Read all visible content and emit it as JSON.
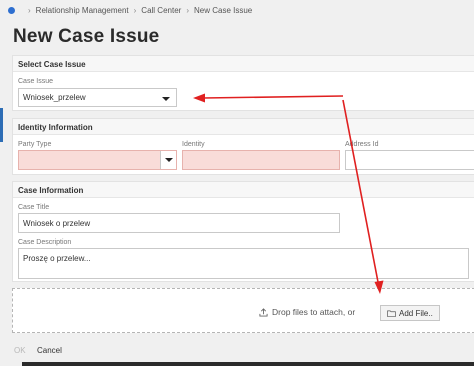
{
  "breadcrumb": {
    "items": [
      "Relationship Management",
      "Call Center",
      "New Case Issue"
    ]
  },
  "page_title": "New Case Issue",
  "select_case_issue": {
    "header": "Select Case Issue",
    "case_issue_label": "Case Issue",
    "case_issue_value": "Wniosek_przelew"
  },
  "identity": {
    "header": "Identity Information",
    "party_type_label": "Party Type",
    "party_type_value": "",
    "identity_label": "Identity",
    "identity_value": "",
    "address_id_label": "Address Id",
    "address_id_value": ""
  },
  "case_info": {
    "header": "Case Information",
    "title_label": "Case Title",
    "title_value": "Wniosek o przelew",
    "description_label": "Case Description",
    "description_value": "Proszę o przelew..."
  },
  "attachments": {
    "drop_text": "Drop files to attach, or",
    "add_file_label": "Add File.."
  },
  "footer": {
    "ok_label": "OK",
    "cancel_label": "Cancel"
  },
  "colors": {
    "accent": "#2e6fd0",
    "error_fill": "#f9dcd9",
    "annotation_arrow": "#e02020"
  }
}
